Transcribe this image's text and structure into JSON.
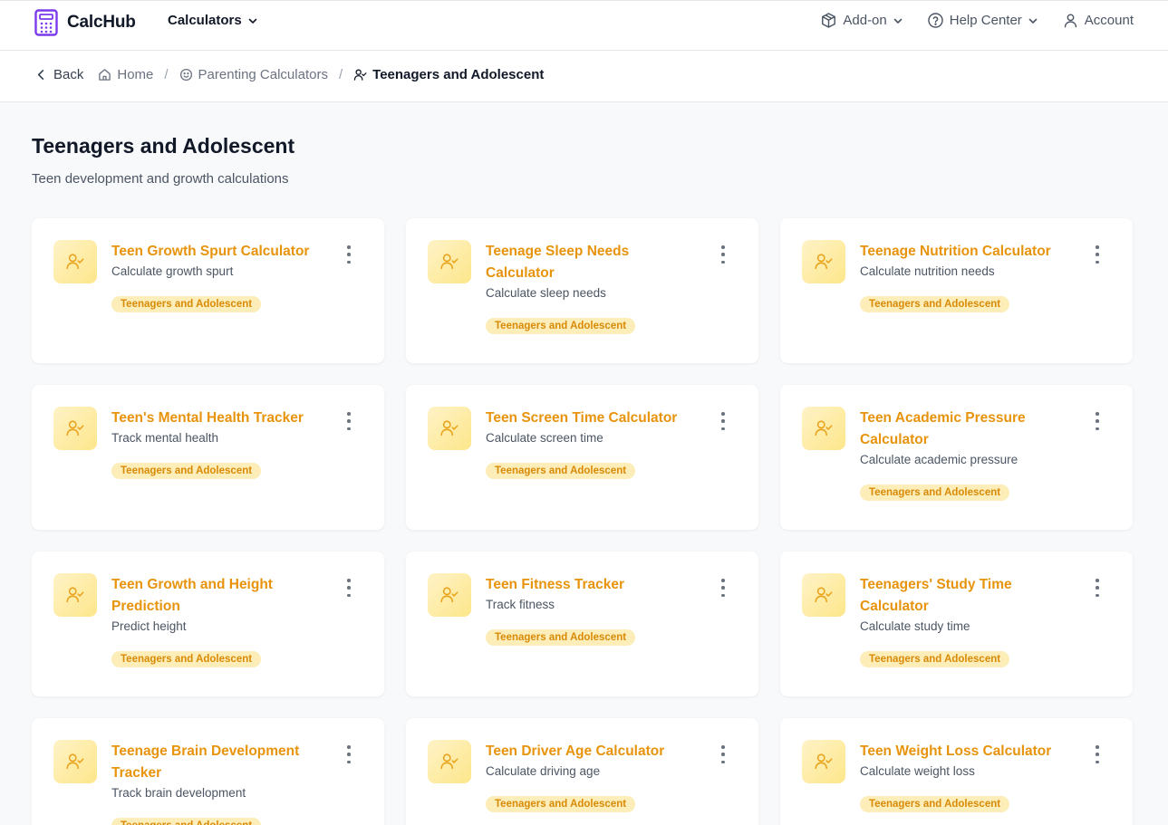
{
  "brand": {
    "name": "CalcHub",
    "icon": "calculator-icon",
    "accent": "#7c3aed"
  },
  "topnav": {
    "calculators_label": "Calculators",
    "addon_label": "Add-on",
    "help_label": "Help Center",
    "account_label": "Account"
  },
  "breadcrumb": {
    "back_label": "Back",
    "home_label": "Home",
    "parent_label": "Parenting Calculators",
    "current_label": "Teenagers and Adolescent"
  },
  "page": {
    "title": "Teenagers and Adolescent",
    "subtitle": "Teen development and growth calculations"
  },
  "colors": {
    "title": "#e8930c",
    "tag_bg": "#fdedb8",
    "tag_text": "#d98a06"
  },
  "cards": [
    {
      "title": "Teen Growth Spurt Calculator",
      "desc": "Calculate growth spurt",
      "tag": "Teenagers and Adolescent"
    },
    {
      "title": "Teenage Sleep Needs Calculator",
      "desc": "Calculate sleep needs",
      "tag": "Teenagers and Adolescent"
    },
    {
      "title": "Teenage Nutrition Calculator",
      "desc": "Calculate nutrition needs",
      "tag": "Teenagers and Adolescent"
    },
    {
      "title": "Teen's Mental Health Tracker",
      "desc": "Track mental health",
      "tag": "Teenagers and Adolescent"
    },
    {
      "title": "Teen Screen Time Calculator",
      "desc": "Calculate screen time",
      "tag": "Teenagers and Adolescent"
    },
    {
      "title": "Teen Academic Pressure Calculator",
      "desc": "Calculate academic pressure",
      "tag": "Teenagers and Adolescent"
    },
    {
      "title": "Teen Growth and Height Prediction",
      "desc": "Predict height",
      "tag": "Teenagers and Adolescent"
    },
    {
      "title": "Teen Fitness Tracker",
      "desc": "Track fitness",
      "tag": "Teenagers and Adolescent"
    },
    {
      "title": "Teenagers' Study Time Calculator",
      "desc": "Calculate study time",
      "tag": "Teenagers and Adolescent"
    },
    {
      "title": "Teenage Brain Development Tracker",
      "desc": "Track brain development",
      "tag": "Teenagers and Adolescent"
    },
    {
      "title": "Teen Driver Age Calculator",
      "desc": "Calculate driving age",
      "tag": "Teenagers and Adolescent"
    },
    {
      "title": "Teen Weight Loss Calculator",
      "desc": "Calculate weight loss",
      "tag": "Teenagers and Adolescent"
    }
  ]
}
